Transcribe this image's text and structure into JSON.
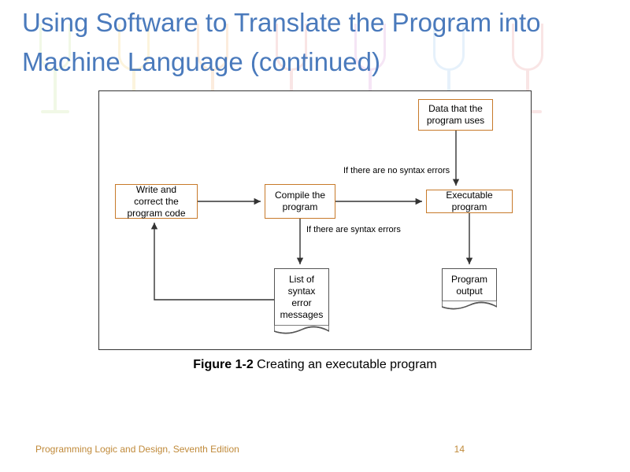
{
  "title": "Using Software to Translate the Program into Machine Language (continued)",
  "diagram": {
    "nodes": {
      "write": "Write and correct the program code",
      "compile": "Compile the program",
      "data": "Data that the program uses",
      "exec": "Executable program",
      "errors": "List of syntax error messages",
      "output": "Program output"
    },
    "edges": {
      "no_errors": "If there are no syntax errors",
      "has_errors": "If there are syntax errors"
    }
  },
  "caption": {
    "label": "Figure 1-2",
    "text": " Creating an executable program"
  },
  "footer": {
    "book": "Programming Logic and Design, Seventh Edition",
    "page": "14"
  },
  "bg_colors": [
    "#c8e6a0",
    "#f5d67a",
    "#f5b87a",
    "#e89a9a",
    "#d89ad8",
    "#a0c8f0",
    "#a0e6d0"
  ]
}
